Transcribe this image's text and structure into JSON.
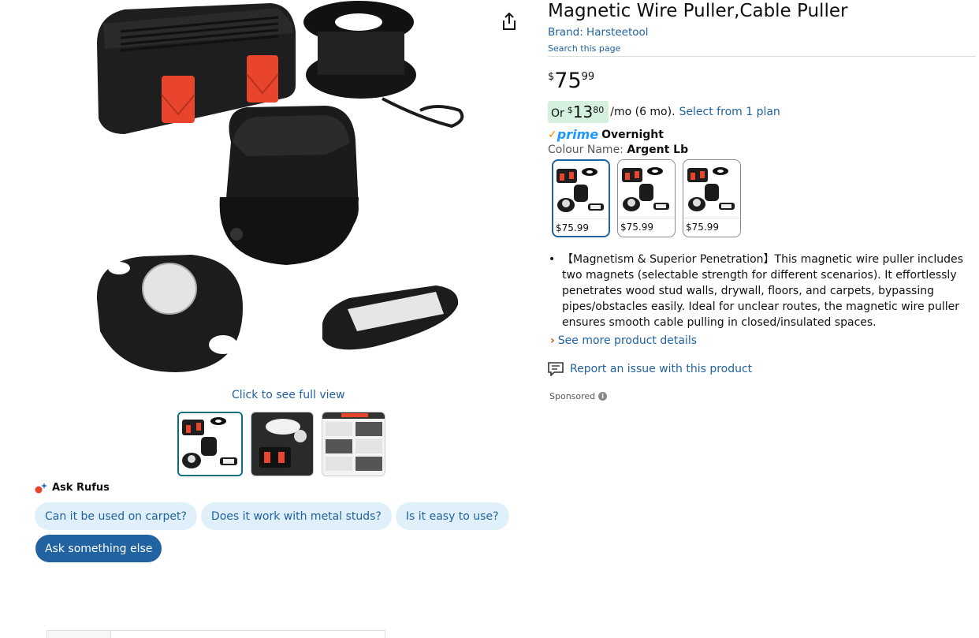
{
  "gallery": {
    "full_view_label": "Click to see full view",
    "thumbnail_count": 3
  },
  "rufus": {
    "heading": "Ask Rufus",
    "chips": [
      "Can it be used on carpet?",
      "Does it work with metal studs?",
      "Is it easy to use?"
    ],
    "ask_else": "Ask something else"
  },
  "product": {
    "title": "Magnetic Wire Puller,Cable Puller",
    "brand": "Brand: Harsteetool",
    "search_page": "Search this page",
    "price": {
      "symbol": "$",
      "whole": "75",
      "fraction": "99"
    },
    "installment": {
      "prefix": "Or",
      "symbol": "$",
      "whole": "13",
      "fraction": "80",
      "suffix": "/mo (6 mo).",
      "plan_link": "Select from 1 plan"
    },
    "prime": {
      "check": "✓",
      "word": "prime",
      "delivery": "Overnight"
    },
    "colour": {
      "label": "Colour Name: ",
      "value": "Argent Lb"
    },
    "swatches": [
      {
        "price": "$75.99",
        "selected": true
      },
      {
        "price": "$75.99",
        "selected": false
      },
      {
        "price": "$75.99",
        "selected": false
      }
    ],
    "bullets": [
      "【Magnetism & Superior Penetration】This magnetic wire puller includes two magnets (selectable strength for different scenarios). It effortlessly penetrates wood stud walls, drywall, floors, and carpets, bypassing pipes/obstacles easily. Ideal for unclear routes, the magnetic wire puller ensures smooth cable pulling in closed/insulated spaces."
    ],
    "see_more": "See more product details",
    "report": "Report an issue with this product",
    "sponsored": "Sponsored"
  },
  "colors": {
    "link": "#2162a1",
    "chip_bg": "#dff0fb",
    "prime_blue": "#1a98ff",
    "accent_orange": "#f08804",
    "highlight_green": "#d6f0e0",
    "device_red": "#e8452c"
  },
  "icons": {
    "share": "share-icon",
    "rufus": "rufus-sparkle-icon",
    "report": "report-flag-icon",
    "info": "info-icon"
  }
}
